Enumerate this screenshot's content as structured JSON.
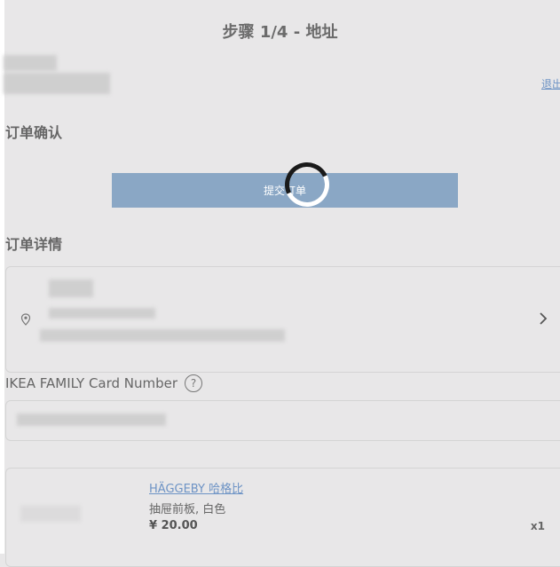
{
  "header": {
    "step_title": "步骤 1/4 - 地址",
    "logout_label": "退出"
  },
  "confirm": {
    "section_title": "订单确认",
    "submit_label": "提交订单"
  },
  "details": {
    "section_title": "订单详情",
    "address_line": "…市…区…镇…"
  },
  "family": {
    "label": "IKEA FAMILY Card Number",
    "help": "?"
  },
  "product": {
    "name": "HÄGGEBY 哈格比",
    "desc": "抽屉前板, 白色",
    "price": "¥ 20.00",
    "qty": "x1"
  },
  "icons": {
    "location": "map-pin-icon",
    "arrow": "chevron-right-icon",
    "help": "question-circle-icon",
    "loading": "spinner-icon"
  },
  "colors": {
    "button": "#8aa7c5",
    "link": "#6d93c5",
    "background": "#e8e7e8"
  }
}
